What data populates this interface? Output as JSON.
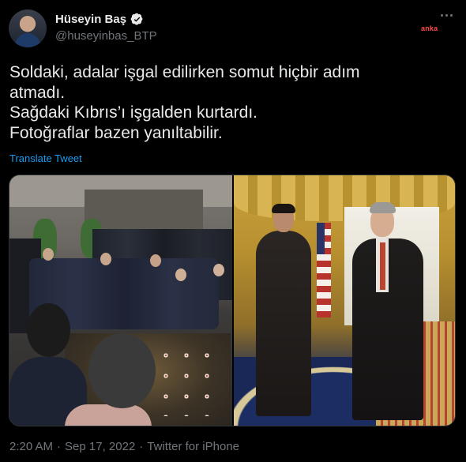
{
  "author": {
    "display_name": "Hüseyin Baş",
    "handle": "@huseyinbas_BTP",
    "verified": true,
    "avatar_icon": "user-avatar"
  },
  "watermark": "anka",
  "tweet": {
    "lines": [
      "Soldaki, adalar işgal edilirken somut hiçbir adım",
      "atmadı.",
      "Sağdaki Kıbrıs’ı işgalden kurtardı.",
      "Fotoğraflar bazen yanıltabilir."
    ],
    "translate_label": "Translate Tweet"
  },
  "media": {
    "count": 2
  },
  "footer": {
    "time": "2:20 AM",
    "date": "Sep 17, 2022",
    "source": "Twitter for iPhone"
  },
  "colors": {
    "background": "#000000",
    "text": "#e7e9ea",
    "secondary": "#71767b",
    "link": "#1d9bf0",
    "verified": "#1d9bf0",
    "watermark": "#ff4d4d"
  }
}
